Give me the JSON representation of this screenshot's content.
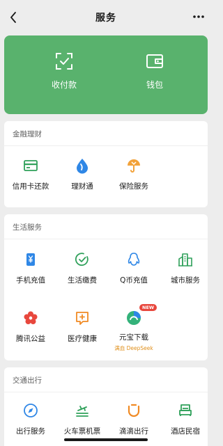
{
  "header": {
    "title": "服务",
    "back_icon": "chevron-left-icon",
    "more_icon": "more-dots-icon"
  },
  "hero": {
    "background": "#59b26d",
    "items": [
      {
        "label": "收付款",
        "icon": "scan-check-icon"
      },
      {
        "label": "钱包",
        "icon": "wallet-icon"
      }
    ]
  },
  "finance": {
    "title": "金融理财",
    "items": [
      {
        "label": "信用卡还款",
        "icon": "credit-card-icon"
      },
      {
        "label": "理财通",
        "icon": "drop-icon"
      },
      {
        "label": "保险服务",
        "icon": "umbrella-icon"
      }
    ]
  },
  "life": {
    "title": "生活服务",
    "items": [
      {
        "label": "手机充值",
        "icon": "phone-yen-icon"
      },
      {
        "label": "生活缴费",
        "icon": "check-circle-icon"
      },
      {
        "label": "Q币充值",
        "icon": "penguin-icon"
      },
      {
        "label": "城市服务",
        "icon": "city-icon"
      },
      {
        "label": "腾讯公益",
        "icon": "flower-icon"
      },
      {
        "label": "医疗健康",
        "icon": "medical-chat-icon"
      },
      {
        "label": "元宝下载",
        "icon": "yuanbao-icon",
        "badge": "NEW",
        "sub": "满血 DeepSeek"
      }
    ]
  },
  "transport": {
    "title": "交通出行",
    "items": [
      {
        "label": "出行服务",
        "icon": "compass-icon"
      },
      {
        "label": "火车票机票",
        "icon": "train-plane-icon"
      },
      {
        "label": "滴滴出行",
        "icon": "didi-icon"
      },
      {
        "label": "酒店民宿",
        "icon": "bed-icon"
      }
    ]
  }
}
